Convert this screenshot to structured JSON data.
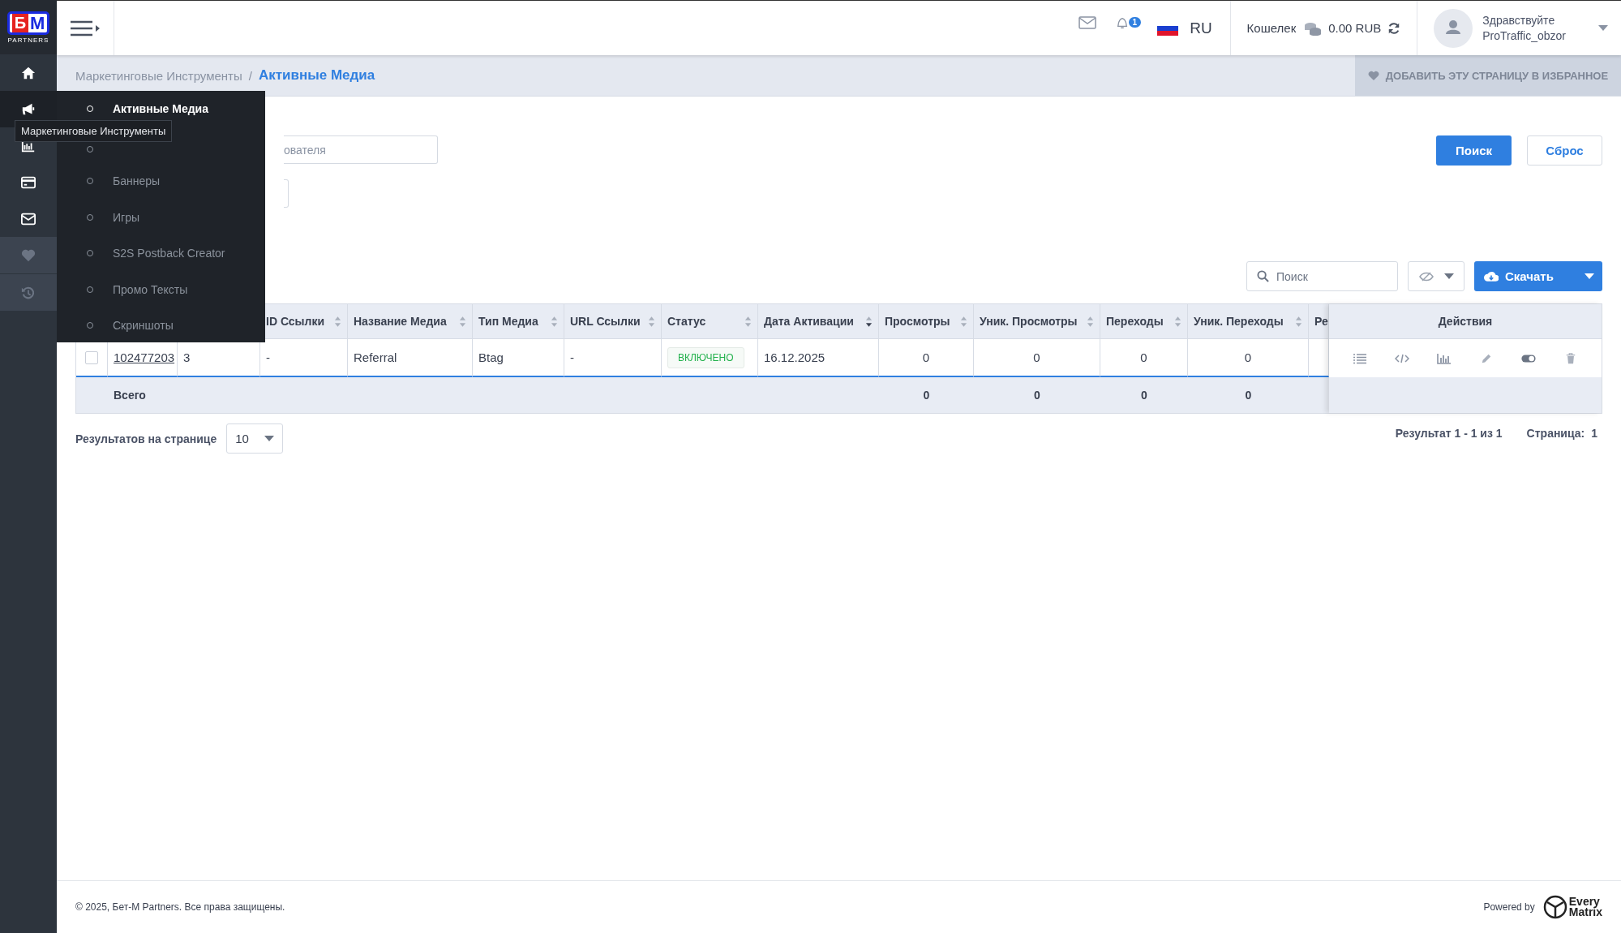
{
  "logo": {
    "mark_left": "Б",
    "mark_right": "М",
    "tagline": "PARTNERS"
  },
  "header": {
    "notifications_badge": "1",
    "language": "RU",
    "wallet_label": "Кошелек",
    "wallet_balance": "0.00 RUB",
    "greeting": "Здравствуйте",
    "username": "ProTraffic_obzor"
  },
  "sidebar": {
    "items": [
      {
        "kind": "home",
        "selected": false,
        "muted": false
      },
      {
        "kind": "megaphone",
        "selected": true,
        "muted": false
      },
      {
        "kind": "chart",
        "selected": false,
        "muted": false
      },
      {
        "kind": "card",
        "selected": false,
        "muted": false
      },
      {
        "kind": "mail",
        "selected": false,
        "muted": false
      },
      {
        "kind": "heart",
        "selected": false,
        "muted": true
      },
      {
        "kind": "history",
        "selected": false,
        "muted": true
      }
    ],
    "tooltip": "Маркетинговые Инструменты"
  },
  "submenu": {
    "items": [
      {
        "label": "Активные Медиа",
        "selected": true
      },
      {
        "selected": false
      },
      {
        "label": "Баннеры",
        "selected": false
      },
      {
        "label": "Игры",
        "selected": false
      },
      {
        "label": "S2S Postback Creator",
        "selected": false
      },
      {
        "label": "Промо Тексты",
        "selected": false
      },
      {
        "label": "Скриншоты",
        "selected": false
      }
    ]
  },
  "breadcrumb": {
    "items": [
      "Маркетинговые Инструменты",
      "Активные Медиа"
    ],
    "separator": "/"
  },
  "favorite_button": "ДОБАВИТЬ ЭТУ СТРАНИЦУ В ИЗБРАННОЕ",
  "filters": {
    "field_placeholder": "ователя",
    "search_button": "Поиск",
    "reset_button": "Сброс"
  },
  "toolbar": {
    "search_placeholder": "Поиск",
    "download_button": "Скачать"
  },
  "table": {
    "columns": [
      {
        "kind": "link"
      },
      {
        "kind": "text"
      },
      {
        "label": "ID Ссылки",
        "kind": "text",
        "sorted": false
      },
      {
        "label": "Название Медиа",
        "kind": "text",
        "sorted": false
      },
      {
        "label": "Тип Медиа",
        "kind": "text",
        "sorted": false
      },
      {
        "label": "URL Ссылки",
        "kind": "text",
        "sorted": false
      },
      {
        "label": "Статус",
        "kind": "status",
        "sorted": false
      },
      {
        "label": "Дата Активации",
        "kind": "text",
        "sorted": true
      },
      {
        "label": "Просмотры",
        "kind": "number",
        "sorted": false
      },
      {
        "label": "Уник. Просмотры",
        "kind": "number",
        "sorted": false
      },
      {
        "label": "Переходы",
        "kind": "number",
        "sorted": false
      },
      {
        "label": "Уник. Переходы",
        "kind": "number",
        "sorted": false
      },
      {
        "label": "Ре",
        "kind": "text"
      }
    ],
    "rows": [
      {
        "checked": false,
        "cells": [
          "102477203",
          "3",
          "-",
          "Referral",
          "Btag",
          "-",
          "ВКЛЮЧЕНО",
          "16.12.2025",
          "0",
          "0",
          "0",
          "0",
          null
        ]
      }
    ],
    "total_row": {
      "cells": [
        "Всего",
        null,
        null,
        null,
        null,
        null,
        null,
        null,
        "0",
        "0",
        "0",
        "0",
        null
      ]
    },
    "actions_header": "Действия",
    "actions": [
      {
        "kind": "list"
      },
      {
        "kind": "code"
      },
      {
        "kind": "chart"
      },
      {
        "kind": "edit"
      },
      {
        "kind": "toggle"
      },
      {
        "kind": "delete"
      }
    ]
  },
  "pagination": {
    "per_page_label": "Результатов на странице",
    "per_page": "10",
    "result": "Результат 1 - 1 из 1",
    "page_label": "Страница:",
    "page": "1"
  },
  "footer": {
    "copyright": "© 2025, Бет-М Partners. Все права защищены.",
    "powered_by": "Powered by",
    "brand_line1": "Every",
    "brand_line2": "Matrix"
  }
}
